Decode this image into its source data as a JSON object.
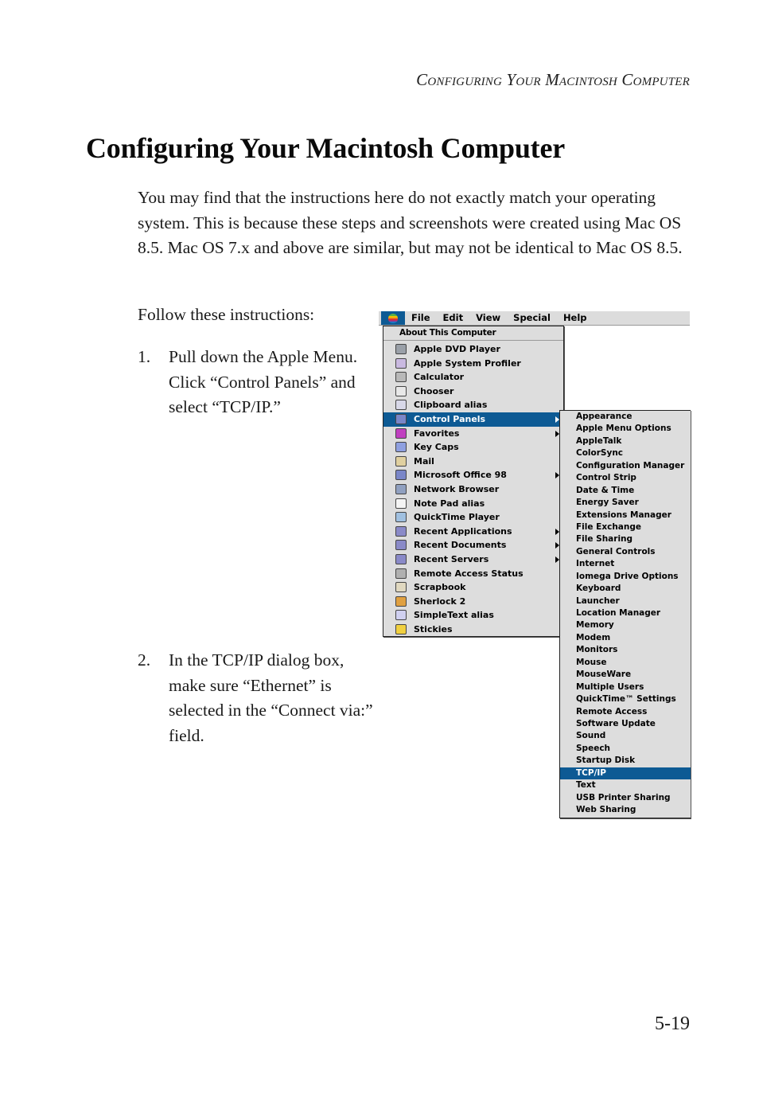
{
  "header": {
    "running_title": "Configuring Your Macintosh Computer"
  },
  "page": {
    "title": "Configuring Your Macintosh Computer",
    "intro": "You may find that the instructions here do not exactly match your operating system. This is because these steps and screenshots were created using Mac OS 8.5. Mac OS 7.x and above are similar, but may not be identical to Mac OS 8.5.",
    "follow": "Follow these instructions:",
    "steps": [
      {
        "number": "1.",
        "text": "Pull down the Apple Menu. Click “Control Panels” and select “TCP/IP.”"
      },
      {
        "number": "2.",
        "text": "In the TCP/IP dialog box, make sure “Ethernet” is selected in the “Connect via:” field."
      }
    ],
    "page_number": "5-19"
  },
  "screenshot": {
    "accent_color": "#0d5a94",
    "menubar": {
      "apple_icon": "apple-rainbow-icon",
      "items": [
        "File",
        "Edit",
        "View",
        "Special",
        "Help"
      ]
    },
    "apple_menu": {
      "about": "About This Computer",
      "items": [
        {
          "label": "Apple DVD Player",
          "icon": "dvd-player-icon",
          "submenu": false,
          "selected": false
        },
        {
          "label": "Apple System Profiler",
          "icon": "system-profiler-icon",
          "submenu": false,
          "selected": false
        },
        {
          "label": "Calculator",
          "icon": "calculator-icon",
          "submenu": false,
          "selected": false
        },
        {
          "label": "Chooser",
          "icon": "chooser-icon",
          "submenu": false,
          "selected": false
        },
        {
          "label": "Clipboard alias",
          "icon": "clipboard-icon",
          "submenu": false,
          "selected": false
        },
        {
          "label": "Control Panels",
          "icon": "control-panels-folder-icon",
          "submenu": true,
          "selected": true
        },
        {
          "label": "Favorites",
          "icon": "favorites-folder-icon",
          "submenu": true,
          "selected": false
        },
        {
          "label": "Key Caps",
          "icon": "key-caps-icon",
          "submenu": false,
          "selected": false
        },
        {
          "label": "Mail",
          "icon": "mail-icon",
          "submenu": false,
          "selected": false
        },
        {
          "label": "Microsoft Office 98",
          "icon": "office-folder-icon",
          "submenu": true,
          "selected": false
        },
        {
          "label": "Network Browser",
          "icon": "network-browser-icon",
          "submenu": false,
          "selected": false
        },
        {
          "label": "Note Pad alias",
          "icon": "note-pad-icon",
          "submenu": false,
          "selected": false
        },
        {
          "label": "QuickTime Player",
          "icon": "quicktime-icon",
          "submenu": false,
          "selected": false
        },
        {
          "label": "Recent Applications",
          "icon": "recent-apps-folder-icon",
          "submenu": true,
          "selected": false
        },
        {
          "label": "Recent Documents",
          "icon": "recent-docs-folder-icon",
          "submenu": true,
          "selected": false
        },
        {
          "label": "Recent Servers",
          "icon": "recent-servers-folder-icon",
          "submenu": true,
          "selected": false
        },
        {
          "label": "Remote Access Status",
          "icon": "remote-access-icon",
          "submenu": false,
          "selected": false
        },
        {
          "label": "Scrapbook",
          "icon": "scrapbook-icon",
          "submenu": false,
          "selected": false
        },
        {
          "label": "Sherlock 2",
          "icon": "sherlock-magnifier-icon",
          "submenu": false,
          "selected": false
        },
        {
          "label": "SimpleText alias",
          "icon": "simpletext-icon",
          "submenu": false,
          "selected": false
        },
        {
          "label": "Stickies",
          "icon": "stickies-icon",
          "submenu": false,
          "selected": false
        }
      ]
    },
    "control_panels_submenu": {
      "items": [
        {
          "label": "Appearance",
          "selected": false
        },
        {
          "label": "Apple Menu Options",
          "selected": false
        },
        {
          "label": "AppleTalk",
          "selected": false
        },
        {
          "label": "ColorSync",
          "selected": false
        },
        {
          "label": "Configuration Manager",
          "selected": false
        },
        {
          "label": "Control Strip",
          "selected": false
        },
        {
          "label": "Date & Time",
          "selected": false
        },
        {
          "label": "Energy Saver",
          "selected": false
        },
        {
          "label": "Extensions Manager",
          "selected": false
        },
        {
          "label": "File Exchange",
          "selected": false
        },
        {
          "label": "File Sharing",
          "selected": false
        },
        {
          "label": "General Controls",
          "selected": false
        },
        {
          "label": "Internet",
          "selected": false
        },
        {
          "label": "Iomega Drive Options",
          "selected": false
        },
        {
          "label": "Keyboard",
          "selected": false
        },
        {
          "label": "Launcher",
          "selected": false
        },
        {
          "label": "Location Manager",
          "selected": false
        },
        {
          "label": "Memory",
          "selected": false
        },
        {
          "label": "Modem",
          "selected": false
        },
        {
          "label": "Monitors",
          "selected": false
        },
        {
          "label": "Mouse",
          "selected": false
        },
        {
          "label": "MouseWare",
          "selected": false
        },
        {
          "label": "Multiple Users",
          "selected": false
        },
        {
          "label": "QuickTime™ Settings",
          "selected": false
        },
        {
          "label": "Remote Access",
          "selected": false
        },
        {
          "label": "Software Update",
          "selected": false
        },
        {
          "label": "Sound",
          "selected": false
        },
        {
          "label": "Speech",
          "selected": false
        },
        {
          "label": "Startup Disk",
          "selected": false
        },
        {
          "label": "TCP/IP",
          "selected": true
        },
        {
          "label": "Text",
          "selected": false
        },
        {
          "label": "USB Printer Sharing",
          "selected": false
        },
        {
          "label": "Web Sharing",
          "selected": false
        }
      ]
    }
  }
}
